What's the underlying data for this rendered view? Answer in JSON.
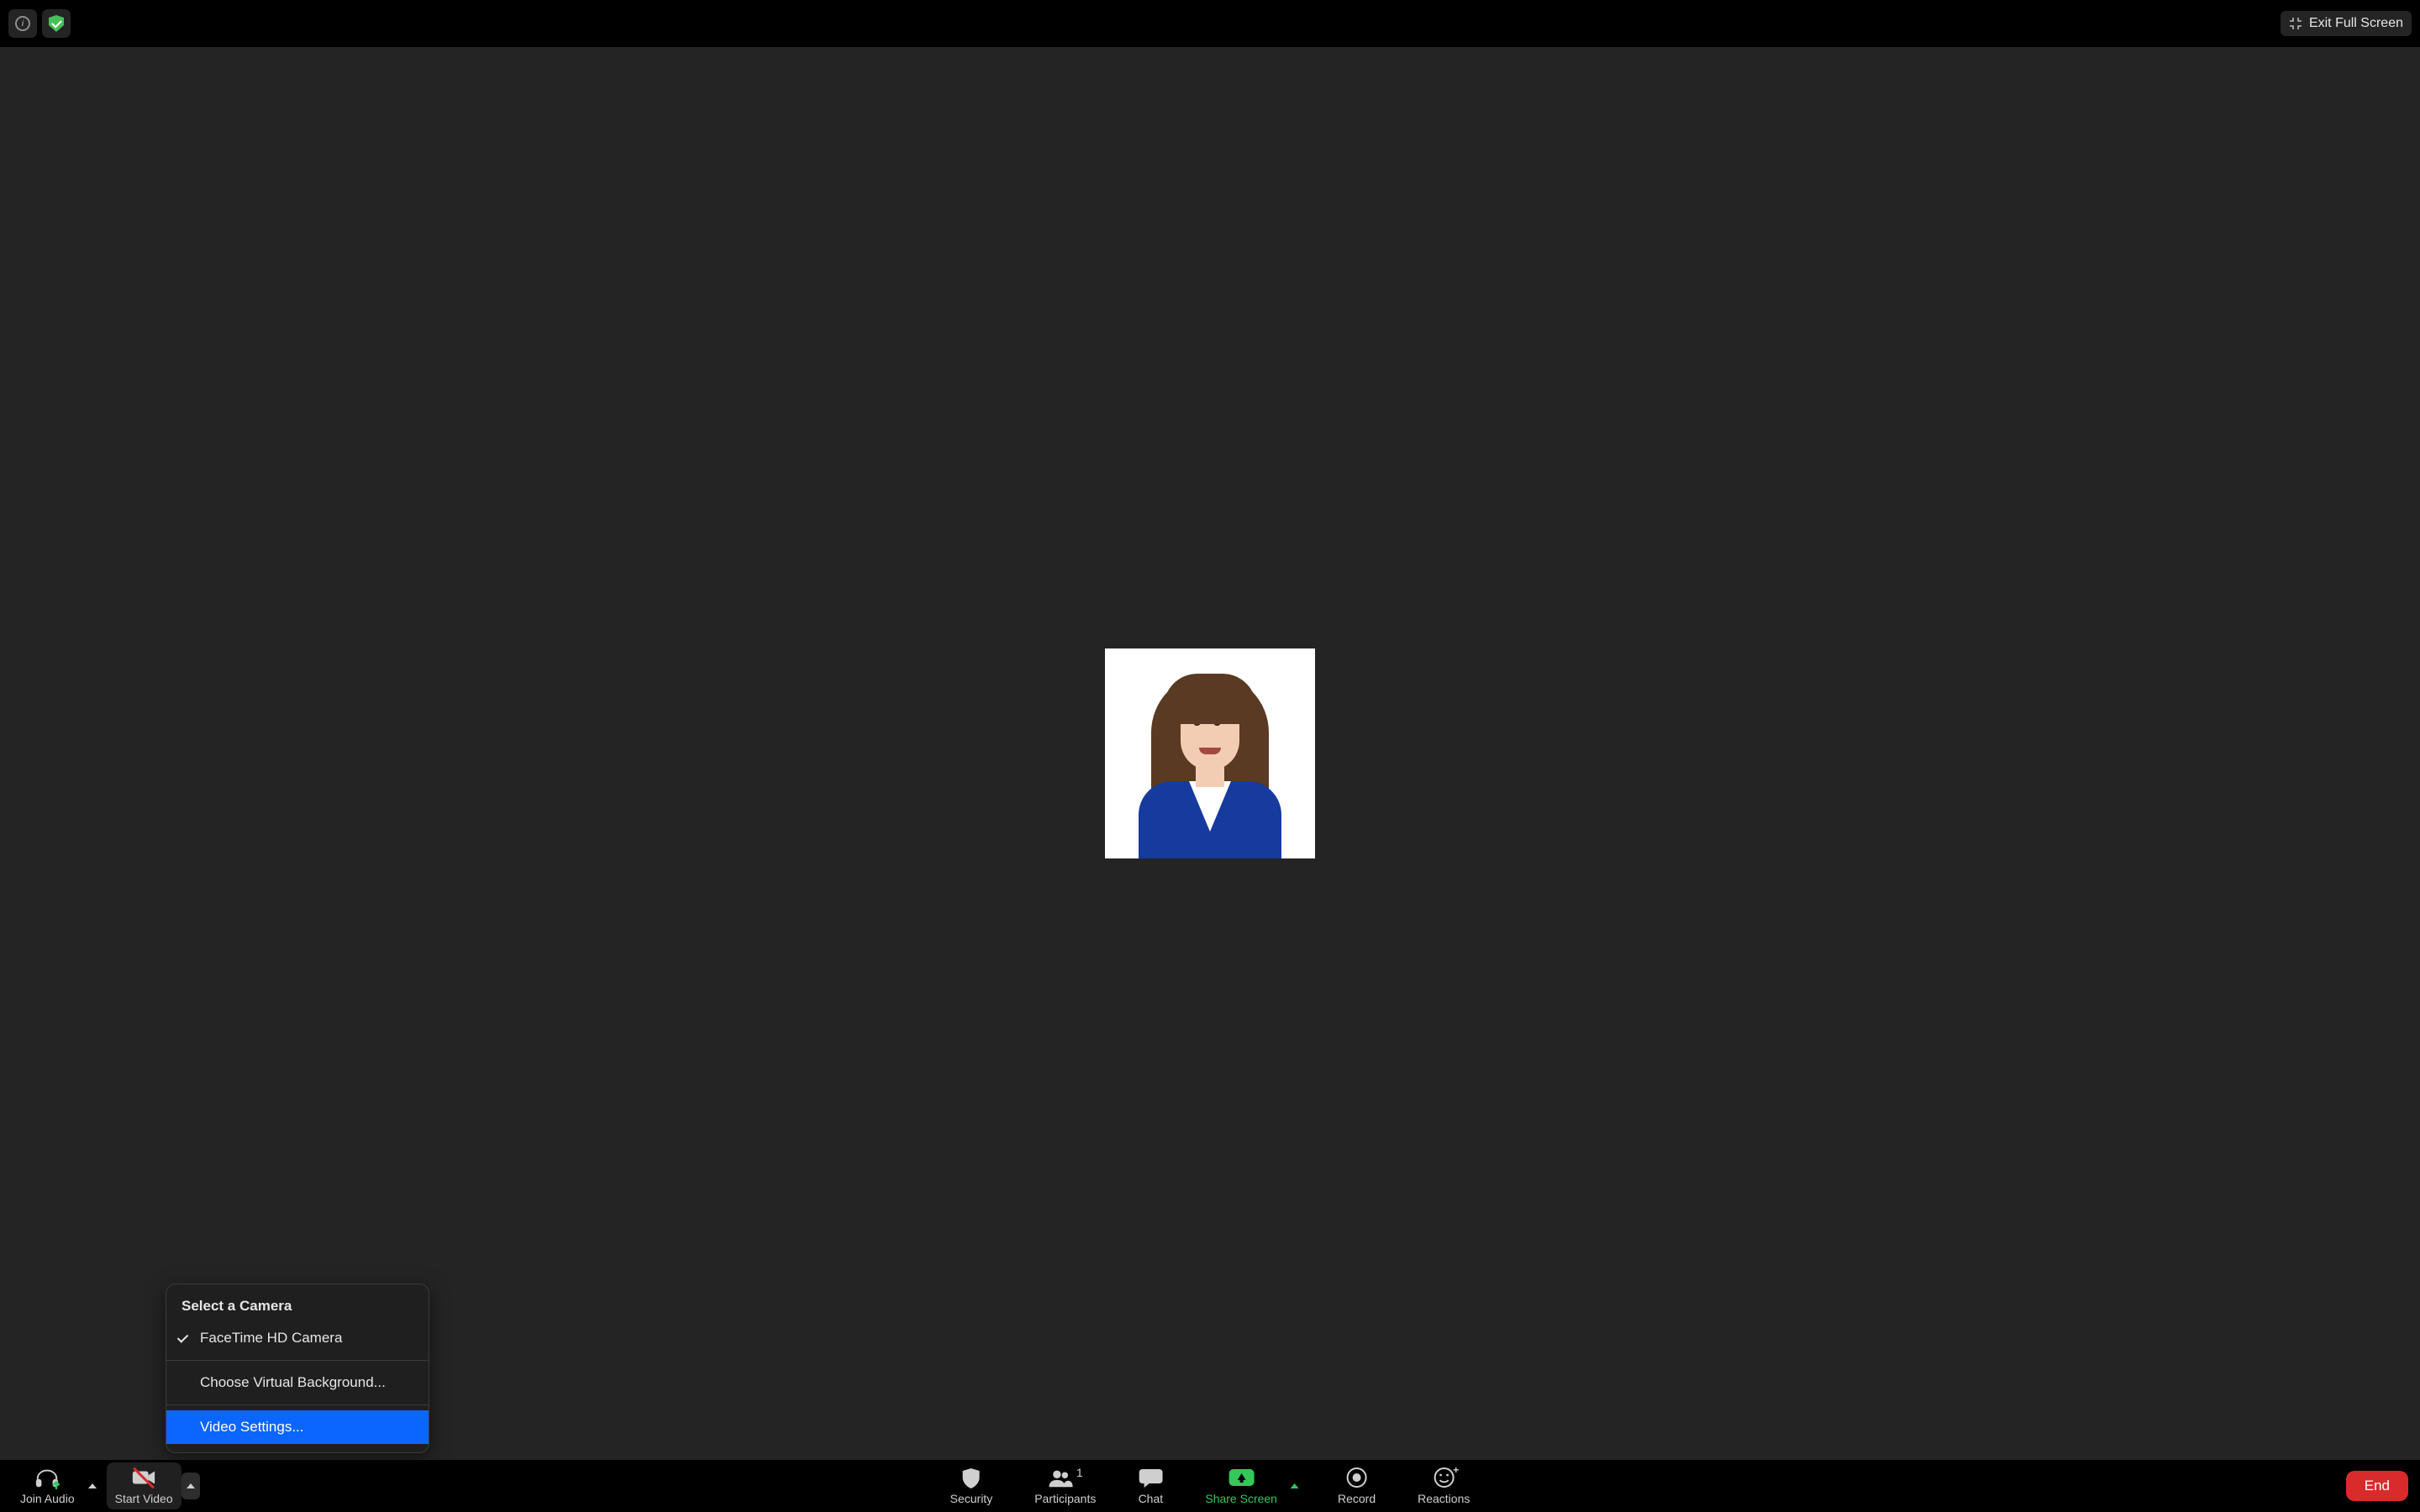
{
  "topbar": {
    "exit_fullscreen_label": "Exit Full Screen"
  },
  "video_menu": {
    "header": "Select a Camera",
    "camera_option": "FaceTime HD Camera",
    "virtual_bg": "Choose Virtual Background...",
    "video_settings": "Video Settings..."
  },
  "toolbar": {
    "join_audio": "Join Audio",
    "start_video": "Start Video",
    "security": "Security",
    "participants": "Participants",
    "participants_count": "1",
    "chat": "Chat",
    "share_screen": "Share Screen",
    "record": "Record",
    "reactions": "Reactions",
    "end": "End"
  }
}
